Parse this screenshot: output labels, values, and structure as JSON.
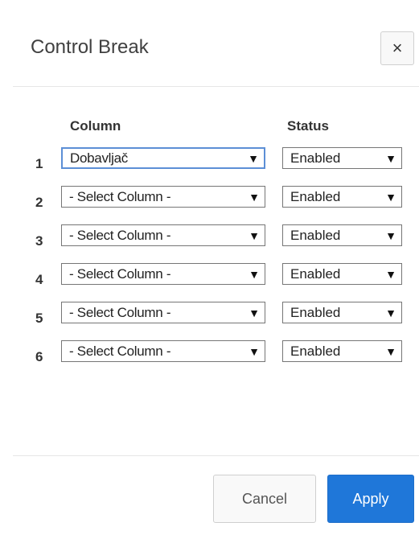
{
  "dialog": {
    "title": "Control Break",
    "close_icon": "close-icon",
    "close_label": "×"
  },
  "table": {
    "headers": {
      "column": "Column",
      "status": "Status"
    },
    "rows": [
      {
        "num": "1",
        "column": "Dobavljač",
        "status": "Enabled"
      },
      {
        "num": "2",
        "column": "- Select Column -",
        "status": "Enabled"
      },
      {
        "num": "3",
        "column": "- Select Column -",
        "status": "Enabled"
      },
      {
        "num": "4",
        "column": "- Select Column -",
        "status": "Enabled"
      },
      {
        "num": "5",
        "column": "- Select Column -",
        "status": "Enabled"
      },
      {
        "num": "6",
        "column": "- Select Column -",
        "status": "Enabled"
      }
    ],
    "arrow_glyph": "▼"
  },
  "footer": {
    "cancel_label": "Cancel",
    "apply_label": "Apply"
  },
  "colors": {
    "accent": "#1f77d9",
    "focus": "#5c8fd6"
  }
}
